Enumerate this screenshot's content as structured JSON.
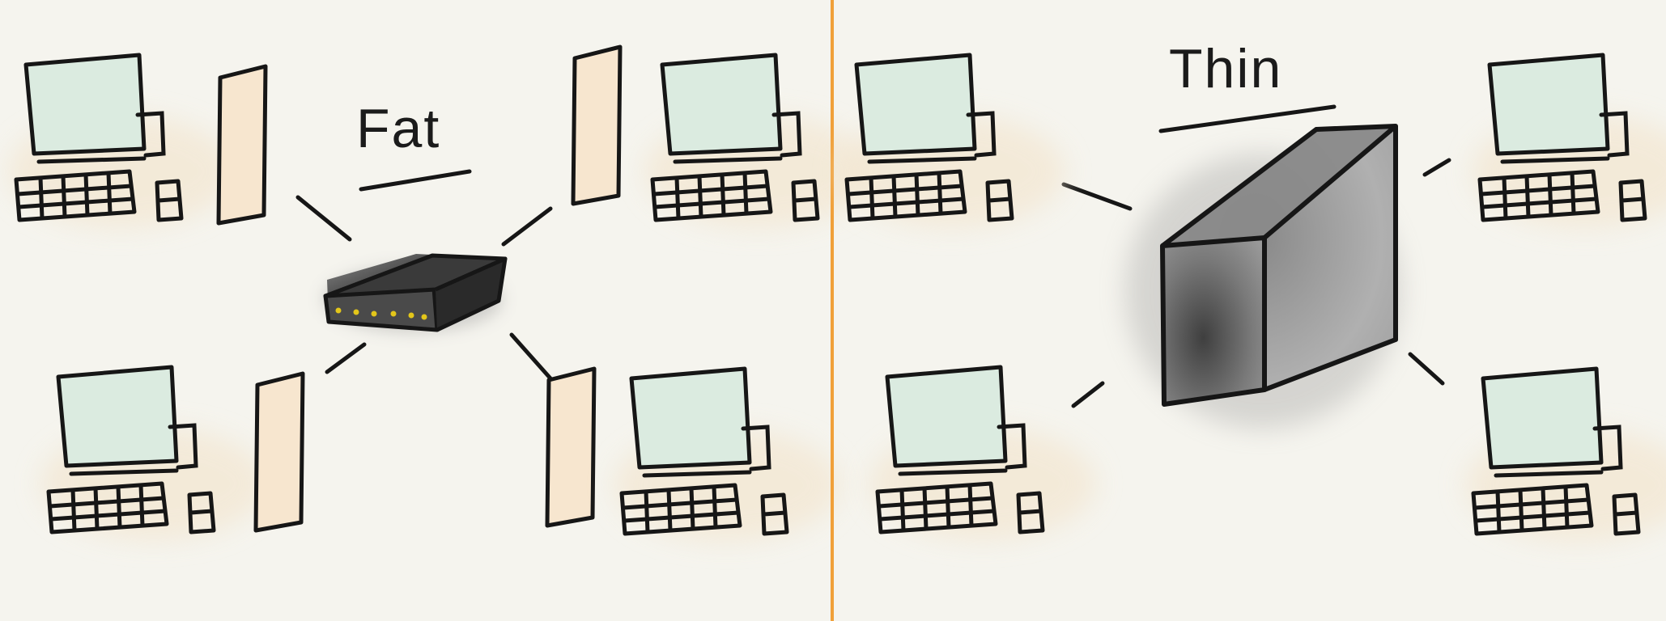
{
  "panels": {
    "left": {
      "title": "Fat"
    },
    "right": {
      "title": "Thin"
    }
  },
  "colors": {
    "background": "#f5f4ee",
    "divider": "#f0a039",
    "screen_fill": "#dbebe0",
    "tower_fill": "#f7e6cf",
    "server_fill": "#6f6f6f",
    "hub_led": "#e3c61a",
    "ink": "#161616"
  },
  "icons": [
    "desktop-computer-icon",
    "tower-pc-icon",
    "network-hub-icon",
    "server-box-icon",
    "keyboard-icon",
    "mouse-icon"
  ]
}
